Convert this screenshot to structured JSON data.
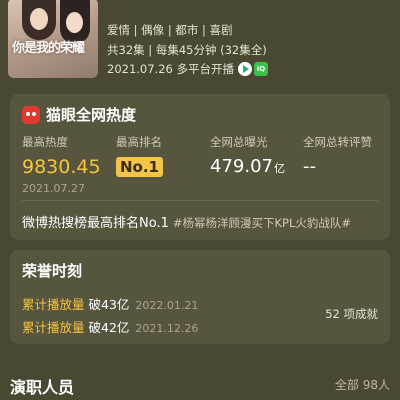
{
  "show": {
    "poster_title": "你是我的荣耀",
    "genres": "爱情 | 偶像 | 都市 | 喜剧",
    "episodes": "共32集 | 每集45分钟 (32集全)",
    "premiere": "2021.07.26 多平台开播",
    "platform_icons": [
      "tencent-video-icon",
      "iqiyi-icon"
    ],
    "iqiyi_text": "iQ"
  },
  "heat": {
    "title": "猫眼全网热度",
    "peak_heat_label": "最高热度",
    "peak_heat_value": "9830.45",
    "peak_heat_date": "2021.07.27",
    "peak_rank_label": "最高排名",
    "peak_rank_value": "No.1",
    "exposure_label": "全网总曝光",
    "exposure_value": "479.07",
    "exposure_unit": "亿",
    "repost_label": "全网总转评赞",
    "repost_value": "--",
    "weibo_text": "微博热搜榜最高排名No.1",
    "weibo_tag": "#杨幂杨洋顾漫买下KPL火豹战队#"
  },
  "honors": {
    "title": "荣誉时刻",
    "items": [
      {
        "kind": "累计播放量",
        "amount": "破43亿",
        "date": "2022.01.21"
      },
      {
        "kind": "累计播放量",
        "amount": "破42亿",
        "date": "2021.12.26"
      }
    ],
    "count": "52 项成就"
  },
  "cast": {
    "title": "演职人员",
    "more": "全部 98人"
  },
  "colors": {
    "background": "#4a4733",
    "card": "#58553f",
    "accent_yellow": "#f6c63d",
    "maoyan_red": "#e03a2f"
  }
}
